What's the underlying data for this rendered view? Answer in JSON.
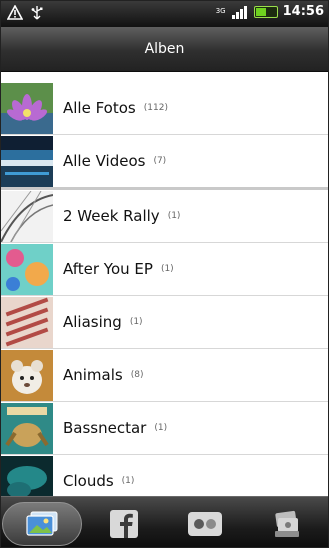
{
  "status_bar": {
    "network_type": "3G",
    "time": "14:56",
    "battery_fill": 0.55,
    "icons": [
      "warning-icon",
      "usb-icon",
      "signal-icon",
      "battery-icon"
    ]
  },
  "header": {
    "title": "Alben"
  },
  "albums": [
    {
      "label": "Alle Fotos",
      "count": "(112)"
    },
    {
      "label": "Alle Videos",
      "count": "(7)"
    },
    {
      "label": "2 Week Rally",
      "count": "(1)"
    },
    {
      "label": "After You EP",
      "count": "(1)"
    },
    {
      "label": "Aliasing",
      "count": "(1)"
    },
    {
      "label": "Animals",
      "count": "(8)"
    },
    {
      "label": "Bassnectar",
      "count": "(1)"
    },
    {
      "label": "Clouds",
      "count": "(1)"
    }
  ],
  "tabs": [
    {
      "icon": "gallery-icon",
      "active": true
    },
    {
      "icon": "facebook-icon",
      "active": false
    },
    {
      "icon": "flickr-icon",
      "active": false
    },
    {
      "icon": "camera-shots-icon",
      "active": false
    }
  ],
  "colors": {
    "accent_battery": "#6fd21f",
    "header_bg": "#2f2f2f"
  }
}
